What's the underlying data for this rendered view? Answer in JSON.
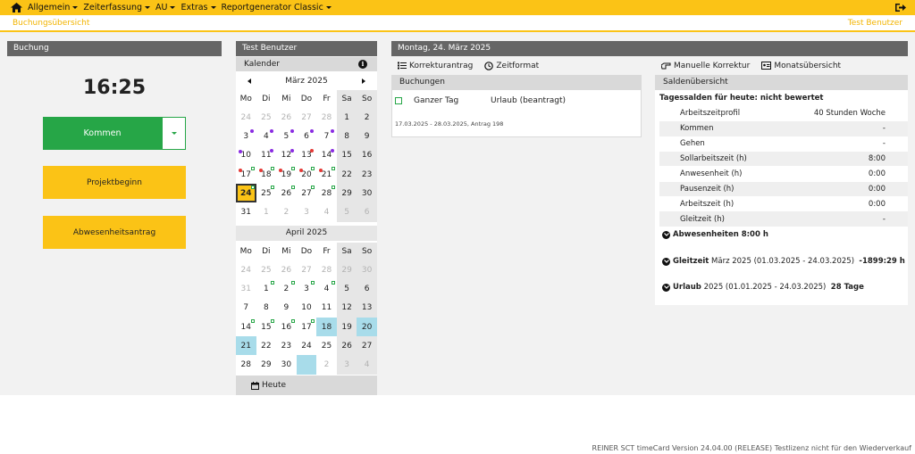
{
  "nav": {
    "items": [
      {
        "label": "Allgemein"
      },
      {
        "label": "Zeiterfassung"
      },
      {
        "label": "AU"
      },
      {
        "label": "Extras"
      },
      {
        "label": "Reportgenerator Classic"
      }
    ]
  },
  "breadcrumb": "Buchungsübersicht",
  "current_user": "Test Benutzer",
  "booking": {
    "header": "Buchung",
    "time": "16:25",
    "kommen_label": "Kommen",
    "projekt_label": "Projektbeginn",
    "abwesenheit_label": "Abwesenheitsantrag"
  },
  "calendar": {
    "user_header": "Test Benutzer",
    "title": "Kalender",
    "weekdays": [
      "Mo",
      "Di",
      "Mi",
      "Do",
      "Fr",
      "Sa",
      "So"
    ],
    "month1": "März 2025",
    "month2": "April 2025",
    "today_label": "Heute",
    "march": [
      [
        "24",
        "25",
        "26",
        "27",
        "28",
        "1",
        "2"
      ],
      [
        "3",
        "4",
        "5",
        "6",
        "7",
        "8",
        "9"
      ],
      [
        "10",
        "11",
        "12",
        "13",
        "14",
        "15",
        "16"
      ],
      [
        "17",
        "18",
        "19",
        "20",
        "21",
        "22",
        "23"
      ],
      [
        "24",
        "25",
        "26",
        "27",
        "28",
        "29",
        "30"
      ],
      [
        "31",
        "1",
        "2",
        "3",
        "4",
        "5",
        "6"
      ]
    ],
    "april": [
      [
        "24",
        "25",
        "26",
        "27",
        "28",
        "29",
        "30"
      ],
      [
        "31",
        "1",
        "2",
        "3",
        "4",
        "5",
        "6"
      ],
      [
        "7",
        "8",
        "9",
        "10",
        "11",
        "12",
        "13"
      ],
      [
        "14",
        "15",
        "16",
        "17",
        "18",
        "19",
        "20"
      ],
      [
        "21",
        "22",
        "23",
        "24",
        "25",
        "26",
        "27"
      ],
      [
        "28",
        "29",
        "30",
        "",
        "2",
        "3",
        "4"
      ]
    ]
  },
  "day": {
    "header": "Montag, 24. März 2025",
    "korrekturantrag": "Korrekturantrag",
    "zeitformat": "Zeitformat",
    "buchungen_title": "Buchungen",
    "entry_type": "Ganzer Tag",
    "entry_status": "Urlaub (beantragt)",
    "entry_note": "17.03.2025 - 28.03.2025, Antrag 198"
  },
  "saldo": {
    "manuelle_korrektur": "Manuelle Korrektur",
    "monatsuebersicht": "Monatsübersicht",
    "title": "Saldenübersicht",
    "tages_title": "Tagessalden für heute: nicht bewertet",
    "rows": [
      {
        "label": "Arbeitszeitprofil",
        "value": "40 Stunden Woche"
      },
      {
        "label": "Kommen",
        "value": "-"
      },
      {
        "label": "Gehen",
        "value": "-"
      },
      {
        "label": "Sollarbeitszeit (h)",
        "value": "8:00"
      },
      {
        "label": "Anwesenheit (h)",
        "value": "0:00"
      },
      {
        "label": "Pausenzeit (h)",
        "value": "0:00"
      },
      {
        "label": "Arbeitszeit (h)",
        "value": "0:00"
      },
      {
        "label": "Gleitzeit (h)",
        "value": "-"
      }
    ],
    "abwesenheiten": "Abwesenheiten 8:00 h",
    "gleitzeit_label": "Gleitzeit",
    "gleitzeit_range": "März 2025 (01.03.2025 - 24.03.2025)",
    "gleitzeit_value": "-1899:29 h",
    "urlaub_label": "Urlaub",
    "urlaub_range": "2025 (01.01.2025 - 24.03.2025)",
    "urlaub_value": "28 Tage"
  },
  "footer": "REINER SCT timeCard Version 24.04.00 (RELEASE) Testlizenz nicht für den Wiederverkauf",
  "colors": {
    "accent": "#fbc316",
    "kommen": "#26a647",
    "header_gray": "#666666",
    "absent": "#a8dcea",
    "dot_purple": "#8a2be2",
    "dot_red": "#e53935"
  }
}
